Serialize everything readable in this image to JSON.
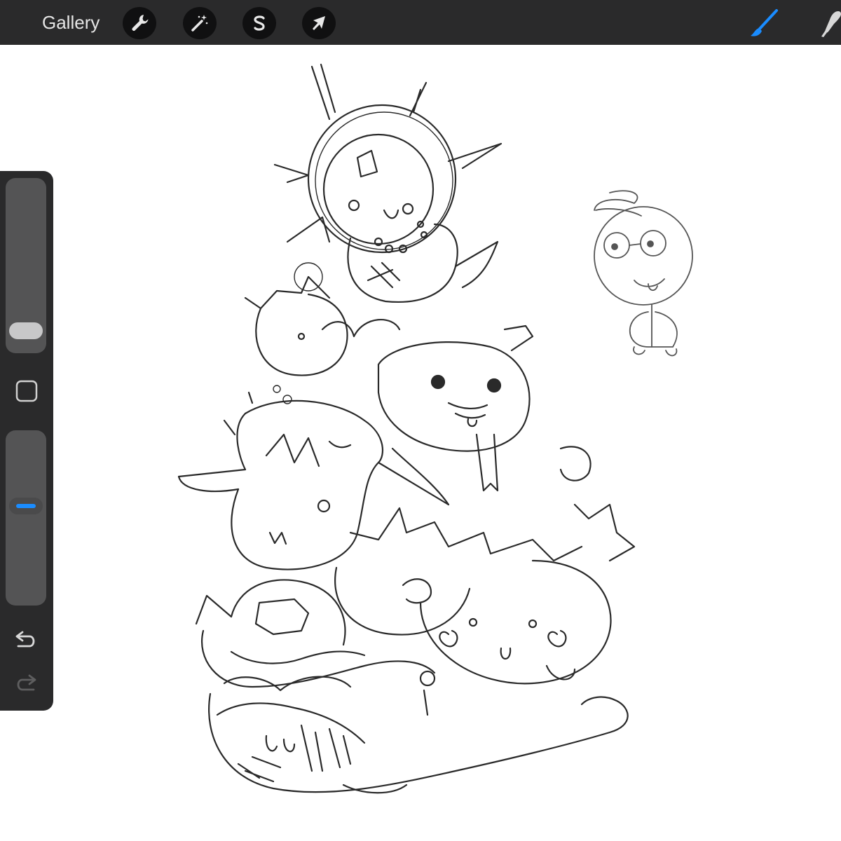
{
  "toolbar": {
    "gallery_label": "Gallery",
    "actions_icon": "wrench-icon",
    "adjustments_icon": "magic-wand-icon",
    "selection_icon": "selection-s-icon",
    "transform_icon": "arrow-cursor-icon",
    "brush_icon": "brush-icon",
    "smudge_icon": "smudge-finger-icon",
    "active_tool_color": "#1a8cff"
  },
  "sidebar": {
    "brush_size_icon": "size-slider",
    "modify_icon": "square-icon",
    "opacity_icon": "opacity-slider",
    "undo_icon": "undo-icon",
    "redo_icon": "redo-icon",
    "accent_color": "#1a8cff"
  },
  "canvas": {
    "background": "#ffffff",
    "content": "pencil-sketch"
  }
}
